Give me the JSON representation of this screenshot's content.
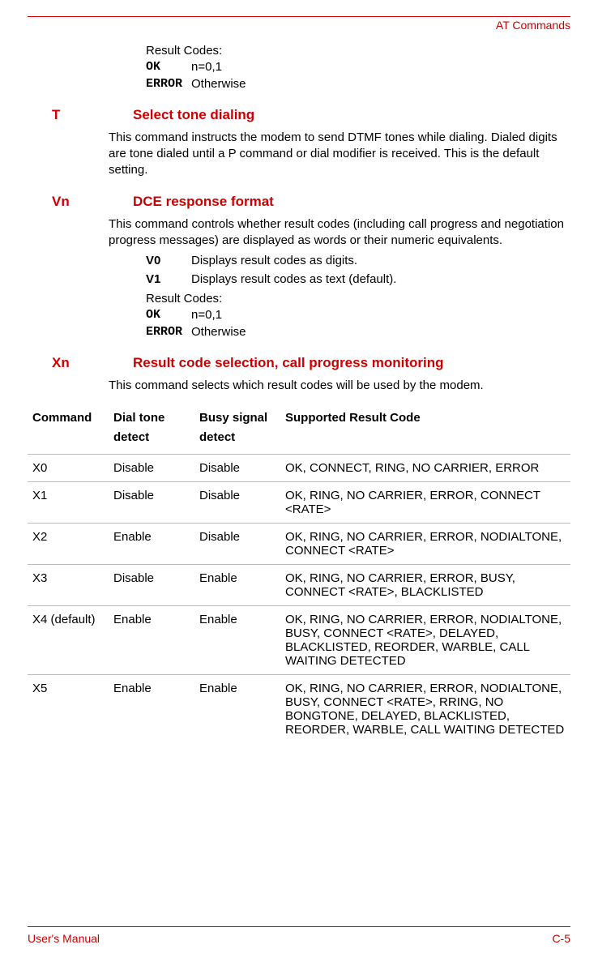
{
  "header": {
    "breadcrumb": "AT Commands"
  },
  "footer": {
    "left": "User's Manual",
    "right": "C-5"
  },
  "result_codes_top": {
    "label": "Result Codes:",
    "ok": {
      "code": "OK",
      "cond": "n=0,1"
    },
    "err": {
      "code": "ERROR",
      "cond": "Otherwise"
    }
  },
  "t": {
    "cmd": "T",
    "title": "Select tone dialing",
    "desc": "This command instructs the modem to send DTMF tones while dialing. Dialed digits are tone dialed until a P command or dial modifier is received. This is the default setting."
  },
  "vn": {
    "cmd": "Vn",
    "title": "DCE response format",
    "desc": "This command controls whether result codes (including call progress and negotiation progress messages) are displayed as words or their numeric equivalents.",
    "v0": {
      "key": "V0",
      "text": "Displays result codes as digits."
    },
    "v1": {
      "key": "V1",
      "text": "Displays result codes as text (default)."
    },
    "rc": {
      "label": "Result Codes:",
      "ok": {
        "code": "OK",
        "cond": "n=0,1"
      },
      "err": {
        "code": "ERROR",
        "cond": "Otherwise"
      }
    }
  },
  "xn": {
    "cmd": "Xn",
    "title": "Result code selection, call progress monitoring",
    "desc": "This command selects which result codes will be used by the modem.",
    "headers": {
      "cmd": "Command",
      "dt": "Dial tone detect",
      "bs": "Busy signal detect",
      "src": "Supported Result Code"
    },
    "rows": [
      {
        "cmd": "X0",
        "dt": "Disable",
        "bs": "Disable",
        "src": "OK, CONNECT, RING, NO CARRIER, ERROR"
      },
      {
        "cmd": "X1",
        "dt": "Disable",
        "bs": "Disable",
        "src": "OK, RING, NO CARRIER, ERROR, CONNECT <RATE>"
      },
      {
        "cmd": "X2",
        "dt": "Enable",
        "bs": "Disable",
        "src": "OK, RING, NO CARRIER, ERROR, NODIALTONE, CONNECT <RATE>"
      },
      {
        "cmd": "X3",
        "dt": "Disable",
        "bs": "Enable",
        "src": "OK, RING, NO CARRIER, ERROR, BUSY, CONNECT <RATE>, BLACKLISTED"
      },
      {
        "cmd": "X4 (default)",
        "dt": "Enable",
        "bs": "Enable",
        "src": "OK, RING, NO CARRIER, ERROR, NODIALTONE, BUSY, CONNECT <RATE>, DELAYED, BLACKLISTED, REORDER, WARBLE, CALL WAITING DETECTED"
      },
      {
        "cmd": "X5",
        "dt": "Enable",
        "bs": "Enable",
        "src": "OK, RING, NO CARRIER, ERROR, NODIALTONE, BUSY, CONNECT <RATE>, RRING, NO BONGTONE, DELAYED, BLACKLISTED, REORDER, WARBLE, CALL WAITING DETECTED"
      }
    ]
  }
}
